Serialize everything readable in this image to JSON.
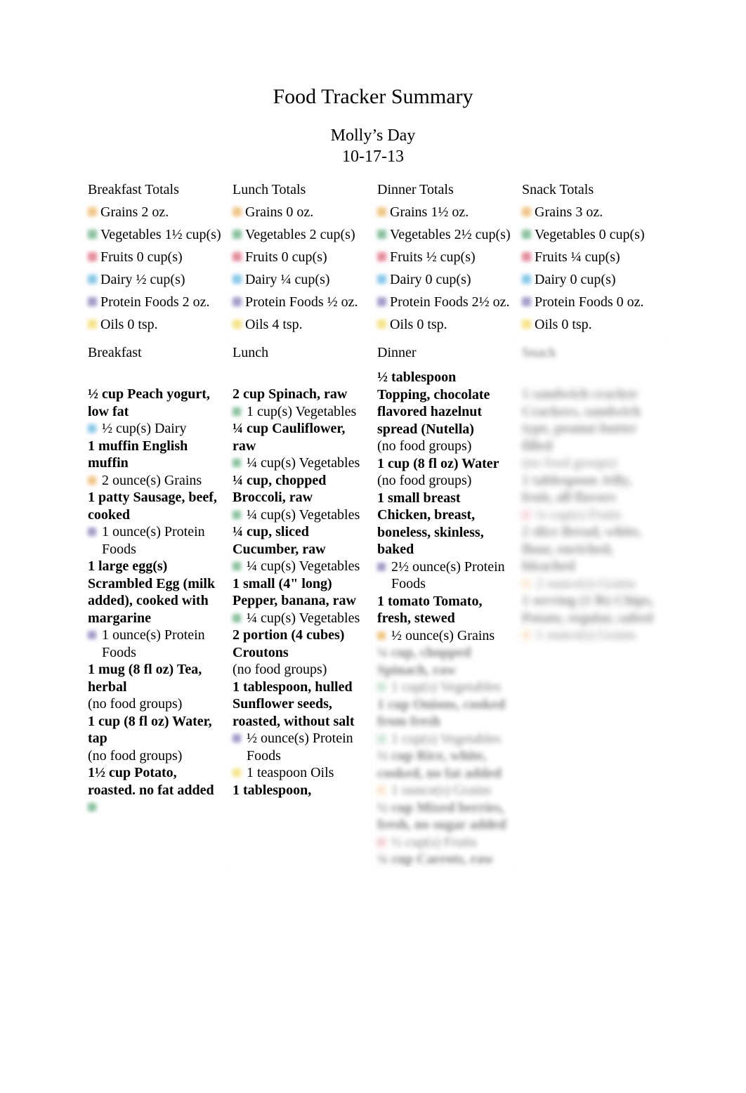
{
  "document": {
    "title": "Food Tracker Summary",
    "subtitle": "Molly’s Day",
    "date": "10-17-13"
  },
  "colors": {
    "grains": "#e8a33d",
    "vegetables": "#3f9c62",
    "fruits": "#d4455e",
    "dairy": "#3fa8dc",
    "protein": "#6a5fa8",
    "oils": "#efd43f",
    "border": "#fcfcfb",
    "text": "#000000"
  },
  "totals": {
    "breakfast": {
      "heading": "Breakfast Totals",
      "rows": [
        {
          "group": "grains",
          "label": "Grains 2 oz."
        },
        {
          "group": "vegetables",
          "label": "Vegetables 1½ cup(s)"
        },
        {
          "group": "fruits",
          "label": "Fruits 0 cup(s)"
        },
        {
          "group": "dairy",
          "label": "Dairy ½ cup(s)"
        },
        {
          "group": "protein",
          "label": "Protein Foods 2 oz."
        },
        {
          "group": "oils",
          "label": "Oils 0 tsp."
        }
      ]
    },
    "lunch": {
      "heading": "Lunch Totals",
      "rows": [
        {
          "group": "grains",
          "label": "Grains 0 oz."
        },
        {
          "group": "vegetables",
          "label": "Vegetables 2 cup(s)"
        },
        {
          "group": "fruits",
          "label": "Fruits 0 cup(s)"
        },
        {
          "group": "dairy",
          "label": "Dairy ¼ cup(s)"
        },
        {
          "group": "protein",
          "label": "Protein Foods ½ oz."
        },
        {
          "group": "oils",
          "label": "Oils 4 tsp."
        }
      ]
    },
    "dinner": {
      "heading": "Dinner Totals",
      "rows": [
        {
          "group": "grains",
          "label": "Grains 1½ oz."
        },
        {
          "group": "vegetables",
          "label": "Vegetables 2½ cup(s)"
        },
        {
          "group": "fruits",
          "label": "Fruits ½ cup(s)"
        },
        {
          "group": "dairy",
          "label": "Dairy 0 cup(s)"
        },
        {
          "group": "protein",
          "label": "Protein Foods 2½ oz."
        },
        {
          "group": "oils",
          "label": "Oils 0 tsp."
        }
      ]
    },
    "snack": {
      "heading": "Snack Totals",
      "rows": [
        {
          "group": "grains",
          "label": "Grains 3 oz."
        },
        {
          "group": "vegetables",
          "label": "Vegetables 0 cup(s)"
        },
        {
          "group": "fruits",
          "label": "Fruits ¼ cup(s)"
        },
        {
          "group": "dairy",
          "label": "Dairy 0 cup(s)"
        },
        {
          "group": "protein",
          "label": "Protein Foods 0 oz."
        },
        {
          "group": "oils",
          "label": "Oils 0 tsp."
        }
      ]
    }
  },
  "details": {
    "breakfast": {
      "heading": "Breakfast",
      "leading_blank": true,
      "items": [
        {
          "name": "½ cup Peach yogurt, low fat",
          "group": "dairy",
          "amount": "½ cup(s) Dairy"
        },
        {
          "name": "1 muffin English muffin",
          "group": "grains",
          "amount": "2 ounce(s) Grains"
        },
        {
          "name": "1 patty Sausage, beef, cooked",
          "group": "protein",
          "amount": "1 ounce(s) Protein Foods"
        },
        {
          "name": "1 large egg(s) Scrambled Egg (milk added), cooked with margarine",
          "group": "protein",
          "amount": "1 ounce(s) Protein Foods"
        },
        {
          "name": "1 mug (8 fl oz) Tea, herbal",
          "group": null,
          "amount": "(no food groups)"
        },
        {
          "name": "1 cup (8 fl oz) Water, tap",
          "group": null,
          "amount": "(no food groups)"
        },
        {
          "name": "1½ cup Potato, roasted. no fat added",
          "group": "vegetables",
          "amount": ""
        }
      ]
    },
    "lunch": {
      "heading": "Lunch",
      "leading_blank": true,
      "items": [
        {
          "name": "2 cup Spinach, raw",
          "group": "vegetables",
          "amount": "1 cup(s) Vegetables"
        },
        {
          "name": "¼ cup Cauliflower, raw",
          "group": "vegetables",
          "amount": "¼ cup(s) Vegetables"
        },
        {
          "name": "¼ cup, chopped Broccoli, raw",
          "group": "vegetables",
          "amount": "¼ cup(s) Vegetables"
        },
        {
          "name": "¼ cup, sliced Cucumber, raw",
          "group": "vegetables",
          "amount": "¼ cup(s) Vegetables"
        },
        {
          "name": "1 small (4\" long) Pepper, banana, raw",
          "group": "vegetables",
          "amount": "¼ cup(s) Vegetables"
        },
        {
          "name": "2 portion (4 cubes) Croutons",
          "group": null,
          "amount": "(no food groups)"
        },
        {
          "name": "1 tablespoon, hulled Sunflower seeds, roasted, without salt",
          "group": "protein",
          "amount": "½ ounce(s) Protein Foods"
        },
        {
          "name": "",
          "group": "oils",
          "amount": "1 teaspoon Oils"
        },
        {
          "name": "1 tablespoon,",
          "group": null,
          "amount": ""
        }
      ]
    },
    "dinner": {
      "heading": "Dinner",
      "leading_blank": false,
      "items": [
        {
          "name": "½ tablespoon Topping, chocolate flavored hazelnut spread (Nutella)",
          "group": null,
          "amount": "(no food groups)"
        },
        {
          "name": "1 cup (8 fl oz) Water",
          "group": null,
          "amount": "(no food groups)"
        },
        {
          "name": "1 small breast Chicken, breast, boneless, skinless, baked",
          "group": "protein",
          "amount": "2½ ounce(s) Protein Foods"
        },
        {
          "name": "1 tomato Tomato, fresh, stewed",
          "group": "grains",
          "amount": "½ ounce(s) Grains"
        }
      ],
      "illegible_items": [
        {
          "name": "¼ cup, chopped Spinach, raw",
          "group": "vegetables",
          "amount": "1 cup(s) Vegetables"
        },
        {
          "name": "1 cup Onions, cooked from fresh",
          "group": "vegetables",
          "amount": "1 cup(s) Vegetables"
        },
        {
          "name": "½ cup Rice, white, cooked, no fat added",
          "group": "grains",
          "amount": "1 ounce(s) Grains"
        },
        {
          "name": "½ cup Mixed berries, fresh, no sugar added",
          "group": "fruits",
          "amount": "½ cup(s) Fruits"
        },
        {
          "name": "¼ cup Carrots, raw",
          "group": "vegetables",
          "amount": "¼ cup(s) Vegetables"
        }
      ]
    },
    "snack": {
      "heading": "Snack",
      "leading_blank": true,
      "illegible_items": [
        {
          "name": "1 sandwich cracker Crackers, sandwich type, peanut butter filled",
          "group": null,
          "amount": "(no food groups)"
        },
        {
          "name": "1 tablespoon Jelly, fruit, all flavors",
          "group": "fruits",
          "amount": "¼ cup(s) Fruits"
        },
        {
          "name": "2 slice Bread, white, flour, enriched, bleached",
          "group": "grains",
          "amount": "2 ounce(s) Grains"
        },
        {
          "name": "1 serving (1 lb) Chips, Potato, regular, salted",
          "group": "grains",
          "amount": "1 ounce(s) Grains"
        }
      ]
    }
  }
}
